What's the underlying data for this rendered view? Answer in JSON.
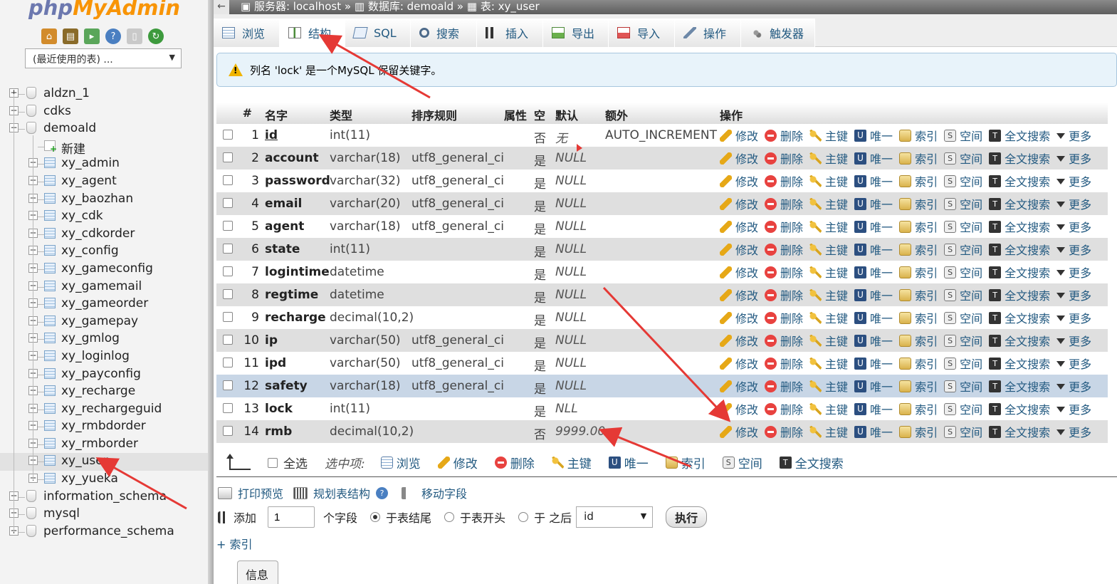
{
  "app": {
    "logo_php": "php",
    "logo_rest": "MyAdmin"
  },
  "sidebar": {
    "recent_select": "(最近使用的表) ...",
    "quick_icons": [
      "home-icon",
      "exit-icon",
      "query-icon",
      "docs-icon",
      "copy-icon",
      "reload-icon"
    ],
    "databases_top": [
      "aldzn_1",
      "cdks"
    ],
    "open_db": "demoald",
    "new_label": "新建",
    "tables": [
      "xy_admin",
      "xy_agent",
      "xy_baozhan",
      "xy_cdk",
      "xy_cdkorder",
      "xy_config",
      "xy_gameconfig",
      "xy_gamemail",
      "xy_gameorder",
      "xy_gamepay",
      "xy_gmlog",
      "xy_loginlog",
      "xy_payconfig",
      "xy_recharge",
      "xy_rechargeguid",
      "xy_rmbdorder",
      "xy_rmborder",
      "xy_user",
      "xy_yueka"
    ],
    "active_table": "xy_user",
    "databases_bottom": [
      "information_schema",
      "mysql",
      "performance_schema"
    ]
  },
  "breadcrumb": {
    "server": "服务器: localhost",
    "database": "数据库: demoald",
    "table": "表: xy_user",
    "sep": "»"
  },
  "tabs": [
    {
      "label": "浏览",
      "icon": "browse-icon"
    },
    {
      "label": "结构",
      "icon": "structure-icon",
      "active": true
    },
    {
      "label": "SQL",
      "icon": "sql-icon"
    },
    {
      "label": "搜索",
      "icon": "search-icon"
    },
    {
      "label": "插入",
      "icon": "insert-icon"
    },
    {
      "label": "导出",
      "icon": "export-icon"
    },
    {
      "label": "导入",
      "icon": "import-icon"
    },
    {
      "label": "操作",
      "icon": "wrench-icon"
    },
    {
      "label": "触发器",
      "icon": "trigger-icon"
    }
  ],
  "notice": {
    "text": "列名 'lock' 是一个MySQL 保留关键字。"
  },
  "columns": {
    "headers": [
      "#",
      "名字",
      "类型",
      "排序规则",
      "属性",
      "空",
      "默认",
      "额外",
      "操作"
    ],
    "rows": [
      {
        "num": "1",
        "name": "id",
        "type": "int(11)",
        "collation": "",
        "null": "否",
        "default": "无",
        "extra": "AUTO_INCREMENT"
      },
      {
        "num": "2",
        "name": "account",
        "type": "varchar(18)",
        "collation": "utf8_general_ci",
        "null": "是",
        "default": "NULL",
        "extra": ""
      },
      {
        "num": "3",
        "name": "password",
        "type": "varchar(32)",
        "collation": "utf8_general_ci",
        "null": "是",
        "default": "NULL",
        "extra": ""
      },
      {
        "num": "4",
        "name": "email",
        "type": "varchar(20)",
        "collation": "utf8_general_ci",
        "null": "是",
        "default": "NULL",
        "extra": ""
      },
      {
        "num": "5",
        "name": "agent",
        "type": "varchar(18)",
        "collation": "utf8_general_ci",
        "null": "是",
        "default": "NULL",
        "extra": ""
      },
      {
        "num": "6",
        "name": "state",
        "type": "int(11)",
        "collation": "",
        "null": "是",
        "default": "NULL",
        "extra": ""
      },
      {
        "num": "7",
        "name": "logintime",
        "type": "datetime",
        "collation": "",
        "null": "是",
        "default": "NULL",
        "extra": ""
      },
      {
        "num": "8",
        "name": "regtime",
        "type": "datetime",
        "collation": "",
        "null": "是",
        "default": "NULL",
        "extra": ""
      },
      {
        "num": "9",
        "name": "recharge",
        "type": "decimal(10,2)",
        "collation": "",
        "null": "是",
        "default": "NULL",
        "extra": ""
      },
      {
        "num": "10",
        "name": "ip",
        "type": "varchar(50)",
        "collation": "utf8_general_ci",
        "null": "是",
        "default": "NULL",
        "extra": ""
      },
      {
        "num": "11",
        "name": "ipd",
        "type": "varchar(50)",
        "collation": "utf8_general_ci",
        "null": "是",
        "default": "NULL",
        "extra": ""
      },
      {
        "num": "12",
        "name": "safety",
        "type": "varchar(18)",
        "collation": "utf8_general_ci",
        "null": "是",
        "default": "NULL",
        "extra": "",
        "highlighted": true
      },
      {
        "num": "13",
        "name": "lock",
        "type": "int(11)",
        "collation": "",
        "null": "是",
        "default": "NLL",
        "extra": ""
      },
      {
        "num": "14",
        "name": "rmb",
        "type": "decimal(10,2)",
        "collation": "",
        "null": "否",
        "default": "9999.00",
        "extra": ""
      }
    ],
    "row_actions": [
      "修改",
      "删除",
      "主键",
      "唯一",
      "索引",
      "空间",
      "全文搜索",
      "更多"
    ]
  },
  "bulk": {
    "check_all": "全选",
    "with_selected": "选中项:",
    "actions": [
      "浏览",
      "修改",
      "删除",
      "主键",
      "唯一",
      "索引",
      "空间",
      "全文搜索"
    ]
  },
  "footer": {
    "print_view": "打印预览",
    "propose_structure": "规划表结构",
    "move_columns": "移动字段",
    "add_label": "添加",
    "add_count": "1",
    "fields_label": "个字段",
    "at_end": "于表结尾",
    "at_start": "于表开头",
    "after": "于 之后",
    "after_column": "id",
    "go": "执行",
    "add_index": "+ 索引",
    "info_tab": "信息"
  },
  "colors": {
    "accent": "#235a81",
    "alert": "#e8423f",
    "warning": "#f0b400",
    "annotation": "#e53935"
  }
}
